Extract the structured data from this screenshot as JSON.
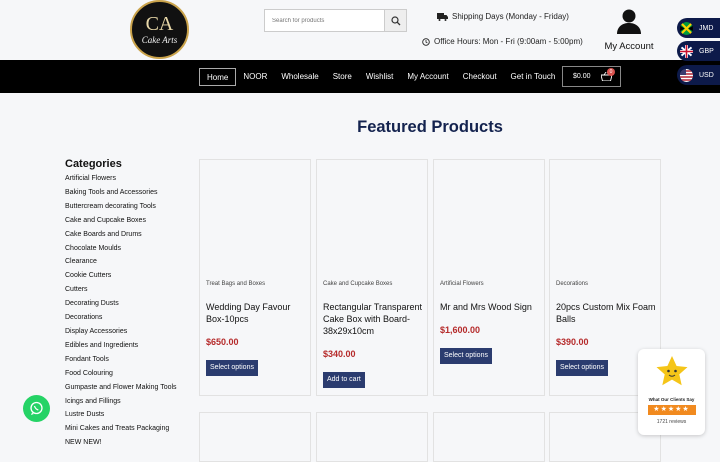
{
  "logo": {
    "monogram": "CA",
    "text": "Cake Arts"
  },
  "search": {
    "placeholder": "Search for products"
  },
  "header": {
    "shipping": "Shipping Days (Monday - Friday)",
    "hours": "Office Hours: Mon - Fri (9:00am - 5:00pm)",
    "account_label": "My Account"
  },
  "nav": {
    "items": [
      "Home",
      "NOOR",
      "Wholesale",
      "Store",
      "Wishlist",
      "My Account",
      "Checkout",
      "Get in Touch"
    ],
    "cart_total": "$0.00",
    "cart_count": "0"
  },
  "currencies": [
    "JMD",
    "GBP",
    "USD"
  ],
  "featured_title": "Featured Products",
  "categories": {
    "title": "Categories",
    "items": [
      "Artificial Flowers",
      "Baking Tools and Accessories",
      "Buttercream decorating Tools",
      "Cake and Cupcake Boxes",
      "Cake Boards and Drums",
      "Chocolate Moulds",
      "Clearance",
      "Cookie Cutters",
      "Cutters",
      "Decorating Dusts",
      "Decorations",
      "Display Accessories",
      "Edibles and Ingredients",
      "Fondant Tools",
      "Food Colouring",
      "Gumpaste and Flower Making Tools",
      "Icings and Fillings",
      "Lustre Dusts",
      "Mini Cakes and Treats Packaging",
      "NEW NEW!"
    ]
  },
  "products": [
    {
      "category": "Treat Bags and Boxes",
      "title": "Wedding Day Favour Box-10pcs",
      "price": "$650.00",
      "button": "Select options"
    },
    {
      "category": "Cake and Cupcake Boxes",
      "title": "Rectangular Transparent Cake Box with Board- 38x29x10cm",
      "price": "$340.00",
      "button": "Add to cart"
    },
    {
      "category": "Artificial Flowers",
      "title": "Mr and Mrs Wood Sign",
      "price": "$1,600.00",
      "button": "Select options"
    },
    {
      "category": "Decorations",
      "title": "20pcs Custom Mix Foam Balls",
      "price": "$390.00",
      "button": "Select options"
    }
  ],
  "reviews": {
    "label": "What Our Clients Say",
    "stars": "★★★★★",
    "count": "1721 reviews"
  }
}
